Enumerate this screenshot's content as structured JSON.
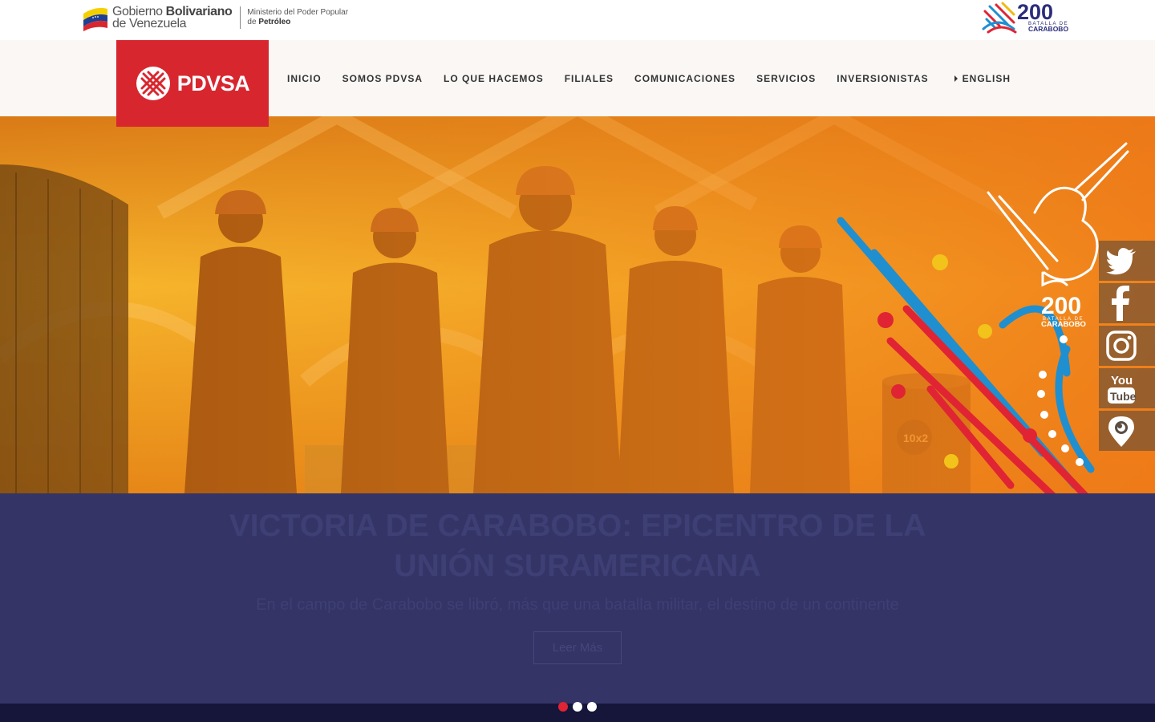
{
  "gov": {
    "line1_a": "Gobierno ",
    "line1_b": "Bolivariano",
    "line2": "de Venezuela",
    "ministry_1": "Ministerio del Poder Popular",
    "ministry_2_a": "de ",
    "ministry_2_b": "Petróleo"
  },
  "badge": {
    "number": "200",
    "sub": "BATALLA DE",
    "name": "CARABOBO"
  },
  "logo": {
    "text": "PDVSA"
  },
  "nav": {
    "items": [
      "INICIO",
      "SOMOS PDVSA",
      "LO QUE HACEMOS",
      "FILIALES",
      "COMUNICACIONES",
      "SERVICIOS",
      "INVERSIONISTAS"
    ],
    "language": "ENGLISH"
  },
  "hero": {
    "tank_label": "10x2",
    "badge_number": "200",
    "badge_sub": "BATALLA DE",
    "badge_name": "CARABOBO"
  },
  "slide": {
    "title": "VICTORIA DE CARABOBO: EPICENTRO DE LA UNIÓN SURAMERICANA",
    "subtitle": "En el campo de Carabobo se libró, más que una batalla militar, el destino de un continente",
    "button": "Leer Más"
  },
  "social": {
    "icons": [
      "twitter-icon",
      "facebook-icon",
      "instagram-icon",
      "youtube-icon",
      "periscope-icon"
    ],
    "youtube_a": "You",
    "youtube_b": "Tube"
  },
  "carousel": {
    "count": 3,
    "active": 1
  },
  "colors": {
    "brand_red": "#d8262f",
    "caption_bg": "#343467",
    "caption_text": "#3e3f74",
    "hero_orange": "#f4a92a"
  }
}
